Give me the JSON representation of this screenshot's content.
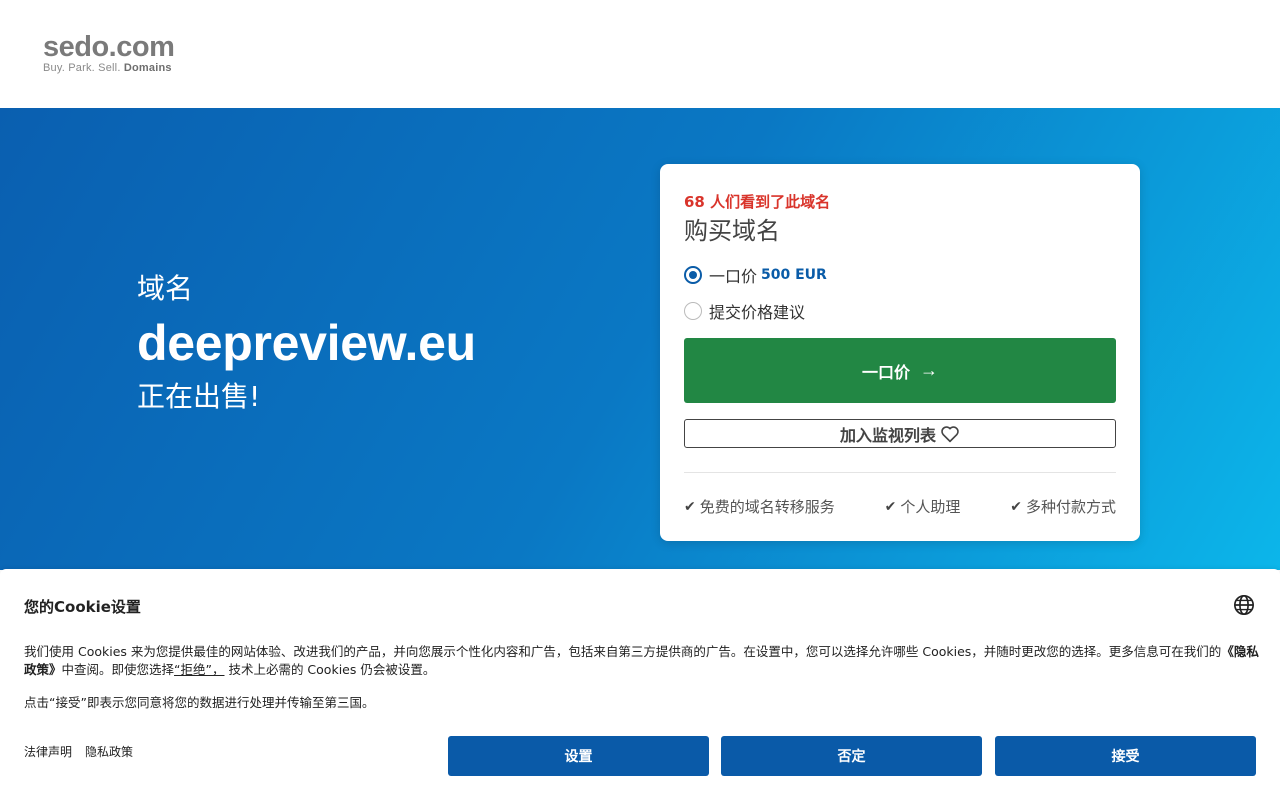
{
  "header": {
    "logo_main": "sedo.com",
    "logo_tag_plain": "Buy.  Park.  Sell.",
    "logo_tag_bold": "Domains"
  },
  "hero": {
    "label": "域名",
    "domain": "deepreview.eu",
    "sale": "正在出售!"
  },
  "card": {
    "views_count": "68",
    "views_text": "人们看到了此域名",
    "title": "购买域名",
    "option_buynow_label": "一口价",
    "option_buynow_price": "500 EUR",
    "option_offer_label": "提交价格建议",
    "buy_button": "一口价",
    "watch_button": "加入监视列表",
    "features": [
      "免费的域名转移服务",
      "个人助理",
      "多种付款方式"
    ]
  },
  "cookie": {
    "title": "您的Cookie设置",
    "text_part1": "我们使用 Cookies 来为您提供最佳的网站体验、改进我们的产品，并向您展示个性化内容和广告，包括来自第三方提供商的广告。在设置中，您可以选择允许哪些 Cookies，并随时更改您的选择。更多信息可在我们的",
    "text_policy": "《隐私政策》",
    "text_part2": "中查阅。即使您选择",
    "text_reject": "“拒绝”，",
    "text_part3": " 技术上必需的 Cookies 仍会被设置。",
    "text_accept_note": "点击“接受”即表示您同意将您的数据进行处理并传输至第三国。",
    "link_legal": "法律声明",
    "link_privacy": "隐私政策",
    "btn_settings": "设置",
    "btn_reject": "否定",
    "btn_accept": "接受"
  },
  "colors": {
    "green": "#228744",
    "blue": "#0a5aa8",
    "red": "#d9342b"
  }
}
